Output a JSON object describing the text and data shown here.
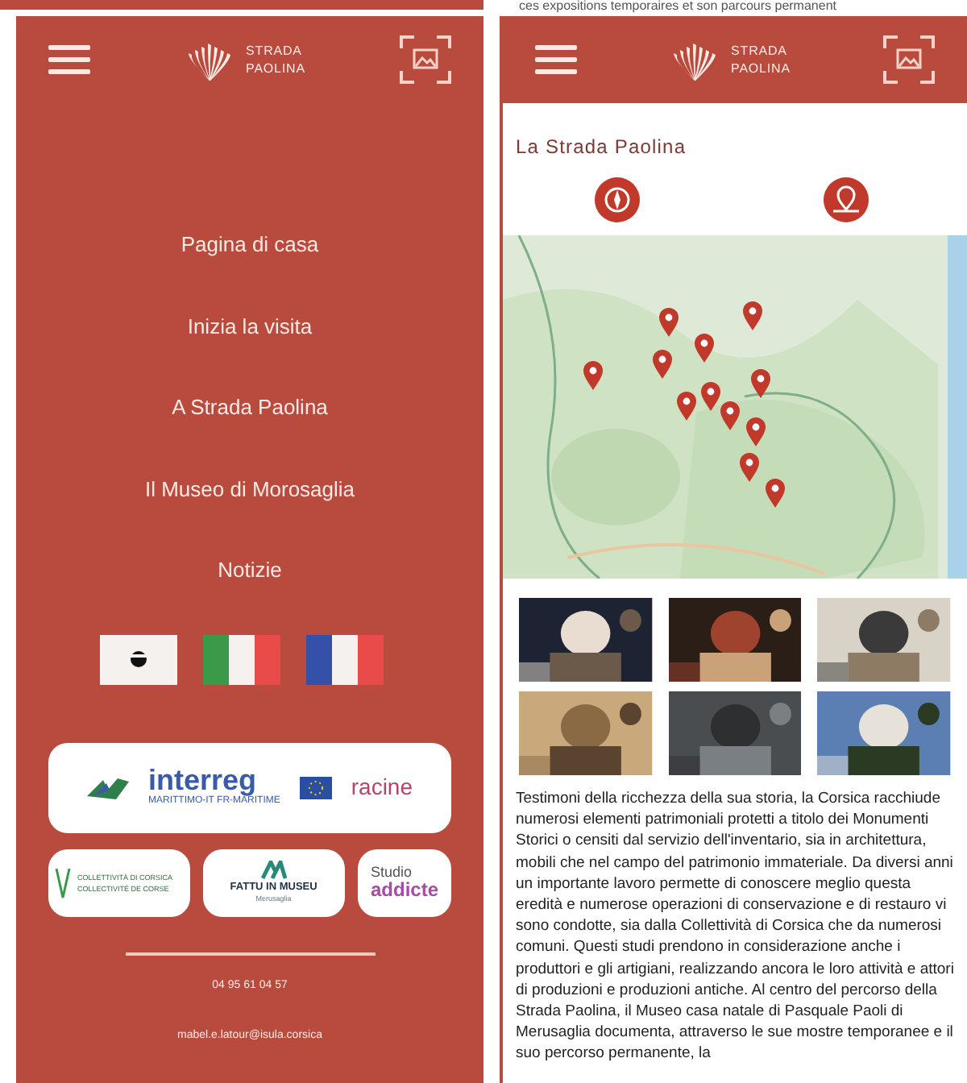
{
  "menu_screen": {
    "logo": [
      "STRADA",
      "PAOLINA"
    ],
    "menu_items": [
      "Pagina di casa",
      "Inizia la visita",
      "A Strada Paolina",
      "Il Museo di Morosaglia",
      "Notizie"
    ],
    "languages": [
      {
        "kind": "corsica",
        "selected": false
      },
      {
        "kind": "italy",
        "selected": false
      },
      {
        "kind": "france",
        "selected": false
      }
    ],
    "partners": {
      "interreg": "interreg",
      "interreg_sub": "MARITTIMO-IT FR-MARITIME",
      "racine": "racine",
      "corsica": [
        "COLLETTIVITÀ DI CORSICA",
        "COLLECTIVITÉ DE CORSE"
      ],
      "fattu": [
        "FATTU IN MUSEU",
        "Merusaglia"
      ],
      "studio": [
        "Studio",
        "addicte"
      ]
    },
    "phone": "04 95 61 04 57",
    "email": "mabel.e.latour@isula.corsica"
  },
  "content_screen": {
    "top_text": "ces expositions temporaires et son parcours permanent",
    "logo": [
      "STRADA",
      "PAOLINA"
    ],
    "title": "La Strada Paolina",
    "photos": [
      {
        "kind": "picture"
      },
      {
        "kind": "picture"
      },
      {
        "kind": "picture"
      },
      {
        "kind": "picture"
      },
      {
        "kind": "picture"
      },
      {
        "kind": "picture"
      }
    ],
    "description": "Testimoni della ricchezza della sua storia, la Corsica racchiude numerosi elementi patrimoniali protetti a titolo dei Monumenti Storici o censiti dal servizio dell'inventario, sia in architettura, mobili che nel campo del patrimonio immateriale. Da diversi anni un importante lavoro permette di conoscere meglio questa eredità e numerose operazioni di conservazione e di restauro vi sono condotte, sia dalla Collettività di Corsica che da numerosi comuni. Questi studi prendono in considerazione anche i produttori e gli artigiani, realizzando ancora le loro attività e attori di produzioni e produzioni antiche.  Al centro del percorso della Strada Paolina, il Museo casa natale di Pasquale Paoli di Merusaglia documenta, attraverso le sue mostre temporanee e il suo percorso permanente, la"
  }
}
